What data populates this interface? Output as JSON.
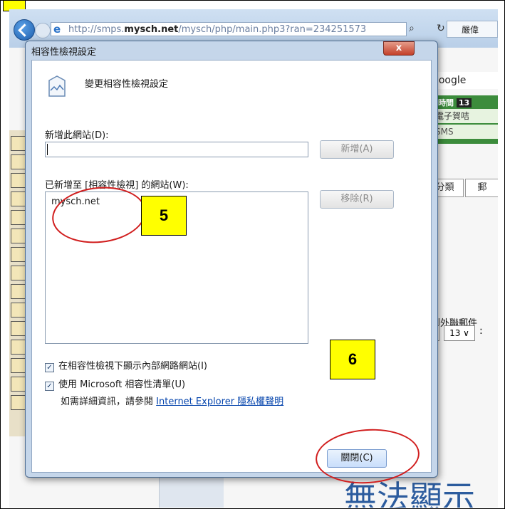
{
  "step_label_top": "",
  "browser": {
    "address_prefix": "http://smps.",
    "address_domain": "mysch.net",
    "address_suffix": "/mysch/php/main.php3?ran=234251573",
    "tab_label": "嚴偉"
  },
  "background_page": {
    "google_label": "Google",
    "system_time_label": "系統時間",
    "system_time_value": "13",
    "ecard_label": "電子賀咭",
    "sms_label": "SMS",
    "tab_auto": "動分類",
    "tab_mail": "郵",
    "send_external_label": "發送到外聯郵件",
    "select_a": "∨",
    "select_13": "13 ∨",
    "colon": ":",
    "big_text": "無法顯示"
  },
  "dialog": {
    "title": "相容性檢視設定",
    "close_label": "x",
    "header_text": "變更相容性檢視設定",
    "add_site_label": "新增此網站(D):",
    "add_site_value": "",
    "add_button": "新增(A)",
    "sites_list_label": "已新增至 [相容性檢視] 的網站(W):",
    "sites": [
      "mysch.net"
    ],
    "remove_button": "移除(R)",
    "checkbox_intranet": {
      "label": "在相容性檢視下顯示內部網路網站(I)",
      "checked": true
    },
    "checkbox_ms_list": {
      "label": "使用 Microsoft 相容性清單(U)",
      "checked": true
    },
    "info_prefix": "如需詳細資訊，請參閱",
    "info_link": "Internet Explorer 隱私權聲明",
    "close_button": "關閉(C)"
  },
  "annotations": {
    "step5": "5",
    "step6": "6",
    "highlight_color": "#ffff00",
    "circle_color": "#d11e1e"
  }
}
